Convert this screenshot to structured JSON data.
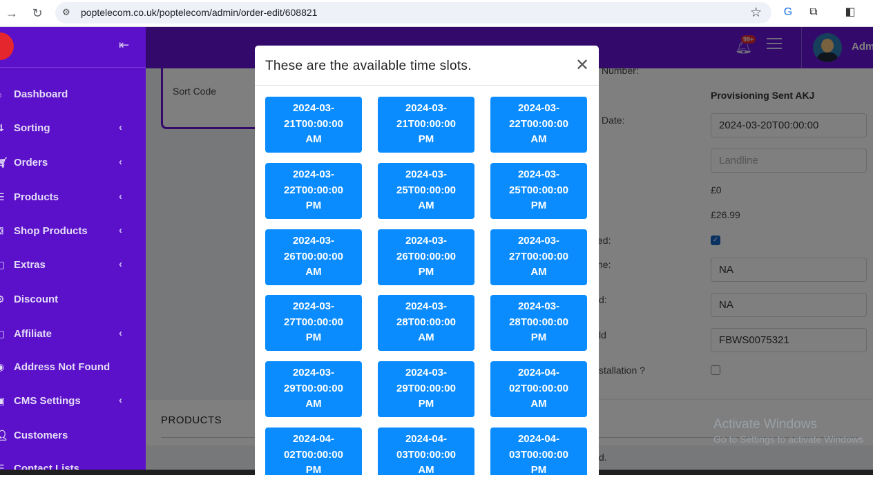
{
  "browser": {
    "url": "poptelecom.co.uk/poptelecom/admin/order-edit/608821"
  },
  "header": {
    "badge": "99+",
    "admin_name": "Adm"
  },
  "sidebar": {
    "items": [
      {
        "label": "Dashboard",
        "icon": "house-icon",
        "has_children": false
      },
      {
        "label": "Sorting",
        "icon": "sort-icon",
        "has_children": true
      },
      {
        "label": "Orders",
        "icon": "cart-icon",
        "has_children": true
      },
      {
        "label": "Products",
        "icon": "list-icon",
        "has_children": true
      },
      {
        "label": "Shop Products",
        "icon": "shop-icon",
        "has_children": true
      },
      {
        "label": "Extras",
        "icon": "square-icon",
        "has_children": true
      },
      {
        "label": "Discount",
        "icon": "gear-icon",
        "has_children": false
      },
      {
        "label": "Affiliate",
        "icon": "square-icon",
        "has_children": true
      },
      {
        "label": "Address Not Found",
        "icon": "eye-icon",
        "has_children": false
      },
      {
        "label": "CMS Settings",
        "icon": "cms-icon",
        "has_children": true
      },
      {
        "label": "Customers",
        "icon": "user-icon",
        "has_children": false
      },
      {
        "label": "Contact Lists",
        "icon": "list-icon",
        "has_children": false
      }
    ]
  },
  "background_form": {
    "sort_code_label": "Sort Code",
    "number_label": "Number:",
    "provisioning_value": "Provisioning Sent AKJ",
    "date_label": "Date:",
    "date_value": "2024-03-20T00:00:00",
    "landline_placeholder": "Landline",
    "price1": "£0",
    "price2": "£26.99",
    "checked_label": "ed:",
    "name_label": "ne:",
    "name_value": "NA",
    "field_label": "d:",
    "field_value": "NA",
    "id_label": "ld",
    "id_value": "FBWS0075321",
    "installation_label": "stallation ?",
    "bottom_label": "d.",
    "products_title": "PRODUCTS"
  },
  "watermark": {
    "line1": "Activate Windows",
    "line2": "Go to Settings to activate Windows"
  },
  "modal": {
    "title": "These are the available time slots.",
    "slots": [
      [
        "2024-03-",
        "21T00:00:00",
        "AM"
      ],
      [
        "2024-03-",
        "21T00:00:00",
        "PM"
      ],
      [
        "2024-03-",
        "22T00:00:00",
        "AM"
      ],
      [
        "2024-03-",
        "22T00:00:00",
        "PM"
      ],
      [
        "2024-03-",
        "25T00:00:00",
        "AM"
      ],
      [
        "2024-03-",
        "25T00:00:00",
        "PM"
      ],
      [
        "2024-03-",
        "26T00:00:00",
        "AM"
      ],
      [
        "2024-03-",
        "26T00:00:00",
        "PM"
      ],
      [
        "2024-03-",
        "27T00:00:00",
        "AM"
      ],
      [
        "2024-03-",
        "27T00:00:00",
        "PM"
      ],
      [
        "2024-03-",
        "28T00:00:00",
        "AM"
      ],
      [
        "2024-03-",
        "28T00:00:00",
        "PM"
      ],
      [
        "2024-03-",
        "29T00:00:00",
        "AM"
      ],
      [
        "2024-03-",
        "29T00:00:00",
        "PM"
      ],
      [
        "2024-04-",
        "02T00:00:00",
        "AM"
      ],
      [
        "2024-04-",
        "02T00:00:00",
        "PM"
      ],
      [
        "2024-04-",
        "03T00:00:00",
        "AM"
      ],
      [
        "2024-04-",
        "03T00:00:00",
        "PM"
      ]
    ]
  }
}
